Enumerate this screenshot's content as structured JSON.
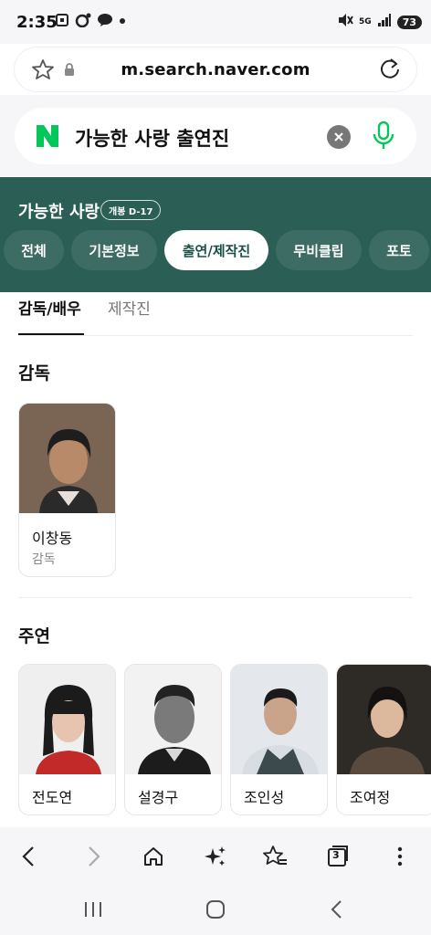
{
  "status_bar": {
    "time": "2:35",
    "battery": "73",
    "network": "5G",
    "left_icons": [
      "screenshot-icon",
      "chat-bubble-icon",
      "kakaotalk-icon",
      "dot-icon"
    ],
    "right_icons": [
      "mute-icon",
      "wifi-icon",
      "signal-icon",
      "battery-icon"
    ]
  },
  "browser": {
    "url": "m.search.naver.com"
  },
  "search": {
    "query": "가능한 사랑 출연진"
  },
  "movie": {
    "title": "가능한 사랑",
    "badge": "개봉 D-17"
  },
  "tabs": [
    {
      "label": "전체",
      "active": false
    },
    {
      "label": "기본정보",
      "active": false
    },
    {
      "label": "출연/제작진",
      "active": true
    },
    {
      "label": "무비클립",
      "active": false
    },
    {
      "label": "포토",
      "active": false
    }
  ],
  "subtabs": [
    {
      "label": "감독/배우",
      "active": true
    },
    {
      "label": "제작진",
      "active": false
    }
  ],
  "sections": {
    "director": {
      "title": "감독",
      "people": [
        {
          "name": "이창동",
          "role": "감독"
        }
      ]
    },
    "lead": {
      "title": "주연",
      "people": [
        {
          "name": "전도연"
        },
        {
          "name": "설경구"
        },
        {
          "name": "조인성"
        },
        {
          "name": "조여정"
        }
      ]
    }
  },
  "toolbar": {
    "tab_count": "3"
  },
  "colors": {
    "header_green": "#2b5e55",
    "naver_green": "#03c75a",
    "tab_inactive": "#3c6c63"
  }
}
